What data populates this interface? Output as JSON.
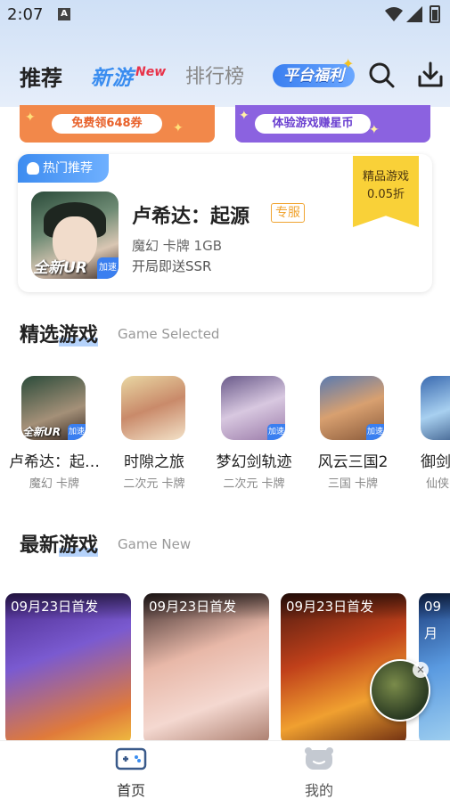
{
  "status_bar": {
    "time": "2:07",
    "notif_icon": "A"
  },
  "nav": {
    "tab_home": "推荐",
    "tab_new": "新游",
    "tab_new_badge": "New",
    "tab_rank": "排行榜",
    "welfare": "平台福利"
  },
  "banners": [
    {
      "label": "免费领648券",
      "color": "#f2884a"
    },
    {
      "label": "体验游戏赚星币",
      "color": "#8b62e0"
    }
  ],
  "hot": {
    "tag": "热门推荐",
    "title": "卢希达：起源",
    "badge": "专服",
    "meta": "魔幻  卡牌  1GB",
    "desc": "开局即送SSR",
    "ribbon_line1": "精品游戏",
    "ribbon_line2": "0.05折",
    "icon_text": "全新UR",
    "speed": "加速"
  },
  "selected": {
    "title_plain": "精选",
    "title_hl": "游戏",
    "subtitle": "Game Selected",
    "items": [
      {
        "name": "卢希达：起…",
        "tags": "魔幻  卡牌",
        "icon_text": "全新UR",
        "speed": "加速"
      },
      {
        "name": "时隙之旅",
        "tags": "二次元  卡牌",
        "icon_text": "",
        "speed": ""
      },
      {
        "name": "梦幻剑轨迹",
        "tags": "二次元  卡牌",
        "icon_text": "",
        "speed": "加速"
      },
      {
        "name": "风云三国2",
        "tags": "三国  卡牌",
        "icon_text": "",
        "speed": "加速"
      },
      {
        "name": "御剑",
        "tags": "仙侠",
        "icon_text": "",
        "speed": ""
      }
    ]
  },
  "latest": {
    "title_plain": "最新",
    "title_hl": "游戏",
    "subtitle": "Game New",
    "items": [
      {
        "date": "09月23日首发"
      },
      {
        "date": "09月23日首发"
      },
      {
        "date": "09月23日首发"
      },
      {
        "date": "09月"
      }
    ]
  },
  "bottom_nav": {
    "home": "首页",
    "mine": "我的"
  },
  "colors": {
    "accent": "#3a8df0",
    "ribbon": "#f9d138",
    "badge": "#f0a431"
  }
}
